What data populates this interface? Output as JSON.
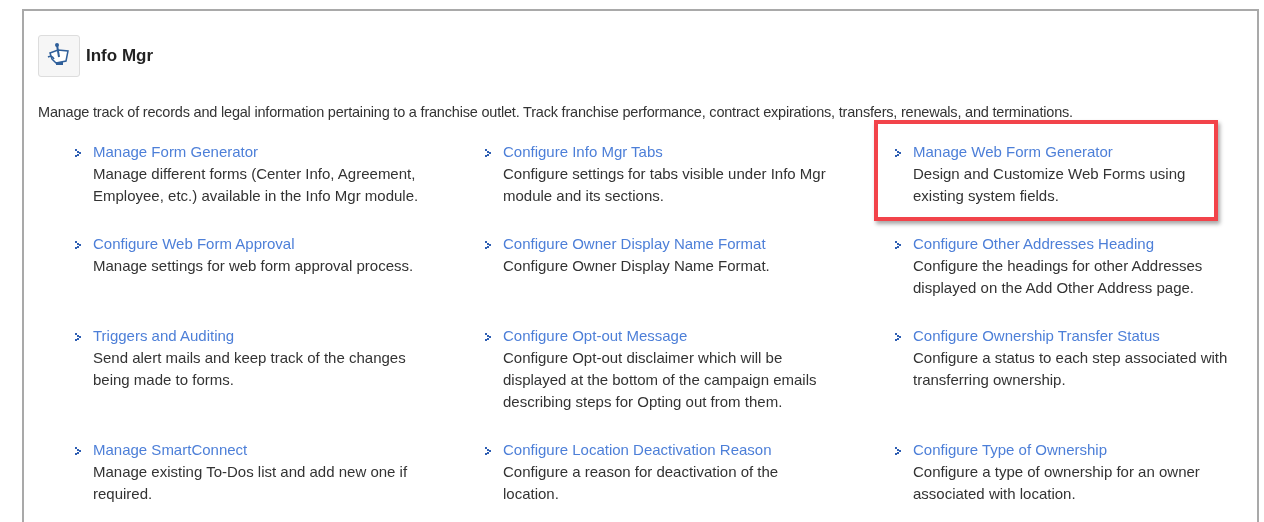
{
  "module": {
    "title": "Info Mgr",
    "description": "Manage track of records and legal information pertaining to a franchise outlet. Track franchise performance, contract expirations, transfers, renewals, and terminations."
  },
  "items": [
    {
      "title": "Manage Form Generator",
      "description": "Manage different forms (Center Info, Agreement, Employee, etc.) available in the Info Mgr module.",
      "highlighted": false
    },
    {
      "title": "Configure Info Mgr Tabs",
      "description": "Configure settings for tabs visible under Info Mgr module and its sections.",
      "highlighted": false
    },
    {
      "title": "Manage Web Form Generator",
      "description": "Design and Customize Web Forms using existing system fields.",
      "highlighted": true
    },
    {
      "title": "Configure Web Form Approval",
      "description": "Manage settings for web form approval process.",
      "highlighted": false
    },
    {
      "title": "Configure Owner Display Name Format",
      "description": "Configure Owner Display Name Format.",
      "highlighted": false
    },
    {
      "title": "Configure Other Addresses Heading",
      "description": "Configure the headings for other Addresses displayed on the Add Other Address page.",
      "highlighted": false
    },
    {
      "title": "Triggers and Auditing",
      "description": "Send alert mails and keep track of the changes being made to forms.",
      "highlighted": false
    },
    {
      "title": "Configure Opt-out Message",
      "description": "Configure Opt-out disclaimer which will be displayed at the bottom of the campaign emails describing steps for Opting out from them.",
      "highlighted": false
    },
    {
      "title": "Configure Ownership Transfer Status",
      "description": "Configure a status to each step associated with transferring ownership.",
      "highlighted": false
    },
    {
      "title": "Manage SmartConnect",
      "description": "Manage existing To-Dos list and add new one if required.",
      "highlighted": false
    },
    {
      "title": "Configure Location Deactivation Reason",
      "description": "Configure a reason for deactivation of the location.",
      "highlighted": false
    },
    {
      "title": "Configure Type of Ownership",
      "description": "Configure a type of ownership for an owner associated with location.",
      "highlighted": false
    }
  ]
}
